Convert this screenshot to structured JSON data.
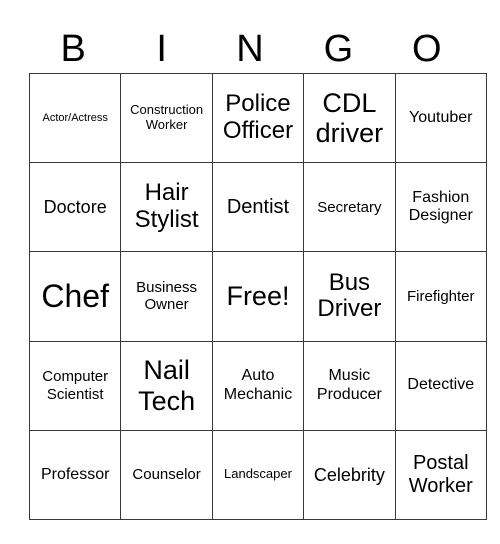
{
  "header": [
    "B",
    "I",
    "N",
    "G",
    "O"
  ],
  "rows": [
    [
      "Actor/Actress",
      "Construction Worker",
      "Police Officer",
      "CDL driver",
      "Youtuber"
    ],
    [
      "Doctore",
      "Hair Stylist",
      "Dentist",
      "Secretary",
      "Fashion Designer"
    ],
    [
      "Chef",
      "Business Owner",
      "Free!",
      "Bus Driver",
      "Firefighter"
    ],
    [
      "Computer Scientist",
      "Nail Tech",
      "Auto Mechanic",
      "Music Producer",
      "Detective"
    ],
    [
      "Professor",
      "Counselor",
      "Landscaper",
      "Celebrity",
      "Postal Worker"
    ]
  ]
}
